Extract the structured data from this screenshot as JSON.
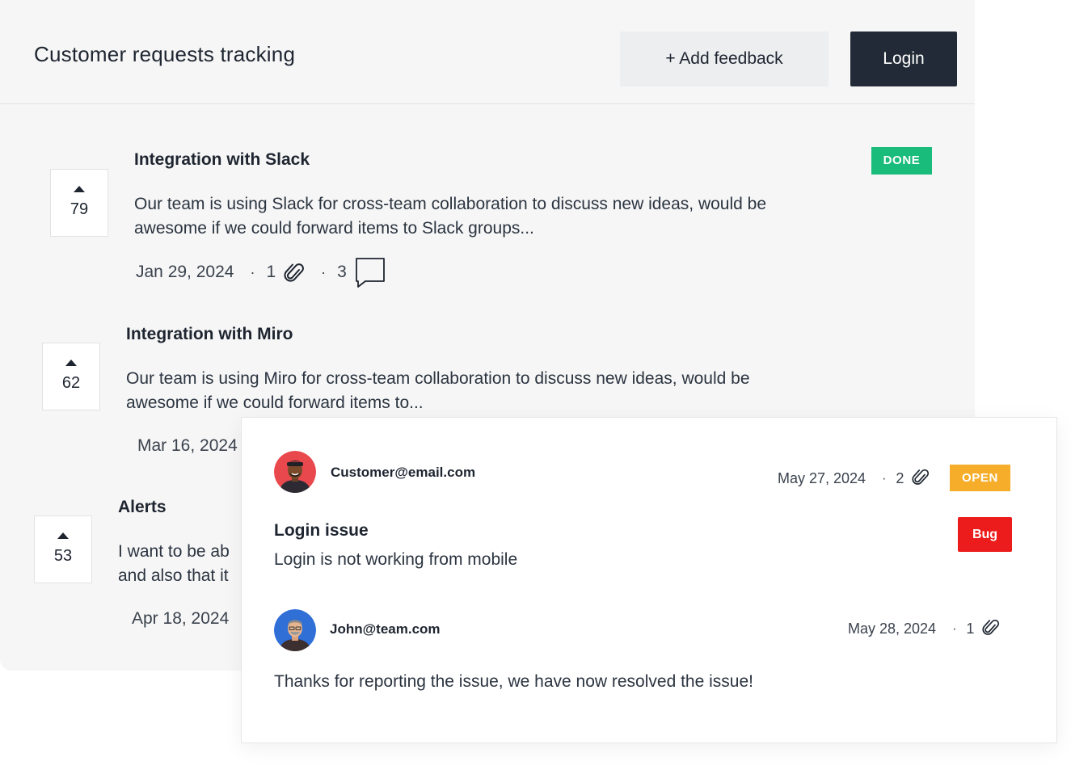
{
  "header": {
    "title": "Customer requests tracking",
    "add_feedback_label": "+ Add feedback",
    "login_label": "Login"
  },
  "items": [
    {
      "votes": "79",
      "title": "Integration with Slack",
      "description_line1": "Our team is using Slack for cross-team collaboration to discuss new ideas, would be",
      "description_line2": "awesome if we could forward items to Slack groups...",
      "date": "Jan 29, 2024",
      "attachments": "1",
      "comments": "3",
      "status": "DONE"
    },
    {
      "votes": "62",
      "title": "Integration with Miro",
      "description_line1": "Our team is using Miro for cross-team collaboration to discuss new ideas, would be",
      "description_line2": "awesome if we could forward items to...",
      "date": "Mar 16, 2024"
    },
    {
      "votes": "53",
      "title": "Alerts",
      "description_line1": "I want to be ab",
      "description_line2": "and also that it",
      "date": "Apr 18, 2024"
    }
  ],
  "popup": {
    "customer": {
      "email": "Customer@email.com",
      "date": "May 27, 2024",
      "attachments": "2",
      "status": "OPEN"
    },
    "issue": {
      "title": "Login issue",
      "description": "Login is not working from mobile",
      "tag": "Bug"
    },
    "reply": {
      "email": "John@team.com",
      "date": "May 28, 2024",
      "attachments": "1",
      "text": "Thanks for reporting the issue, we have now resolved the issue!"
    }
  },
  "colors": {
    "done": "#1abc7b",
    "open": "#f5ad2a",
    "bug": "#ec1c1c",
    "login_button": "#212a36"
  },
  "icons": [
    "upvote-arrow-icon",
    "paperclip-icon",
    "comment-icon",
    "avatar-photo"
  ]
}
